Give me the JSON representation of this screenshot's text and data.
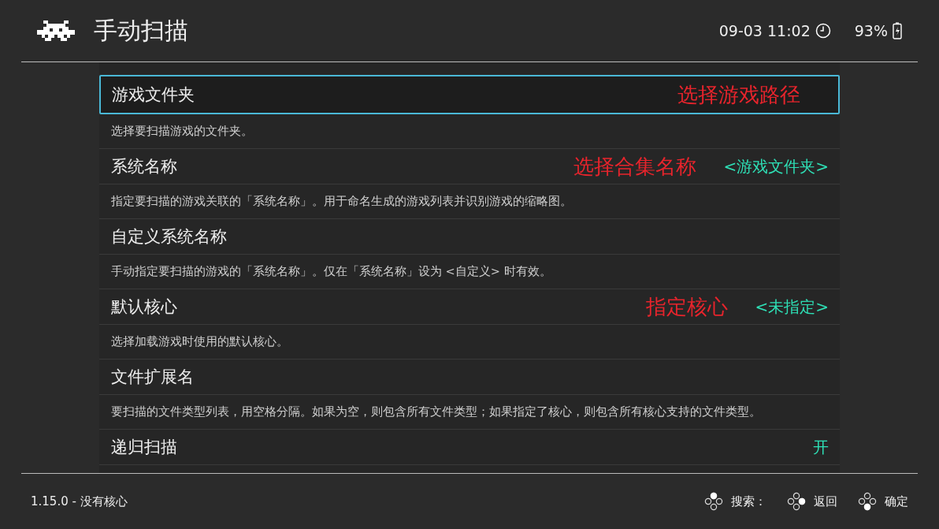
{
  "header": {
    "title": "手动扫描",
    "datetime": "09-03 11:02",
    "battery": "93%"
  },
  "items": [
    {
      "title": "游戏文件夹",
      "description": "选择要扫描游戏的文件夹。",
      "selected": true,
      "annotation": "选择游戏路径"
    },
    {
      "title": "系统名称",
      "description": "指定要扫描的游戏关联的「系统名称」。用于命名生成的游戏列表并识别游戏的缩略图。",
      "selected": false,
      "value": "<游戏文件夹>",
      "annotation": "选择合集名称"
    },
    {
      "title": "自定义系统名称",
      "description": "手动指定要扫描的游戏的「系统名称」。仅在「系统名称」设为 <自定义> 时有效。",
      "selected": false
    },
    {
      "title": "默认核心",
      "description": "选择加载游戏时使用的默认核心。",
      "selected": false,
      "value": "<未指定>",
      "annotation": "指定核心"
    },
    {
      "title": "文件扩展名",
      "description": "要扫描的文件类型列表，用空格分隔。如果为空，则包含所有文件类型；如果指定了核心，则包含所有核心支持的文件类型。",
      "selected": false
    },
    {
      "title": "递归扫描",
      "selected": false,
      "value": "开"
    }
  ],
  "footer": {
    "version": "1.15.0 - 没有核心",
    "hints": [
      {
        "kind": "top",
        "label": "搜索："
      },
      {
        "kind": "right",
        "label": "返回"
      },
      {
        "kind": "bottom",
        "label": "确定"
      }
    ]
  }
}
